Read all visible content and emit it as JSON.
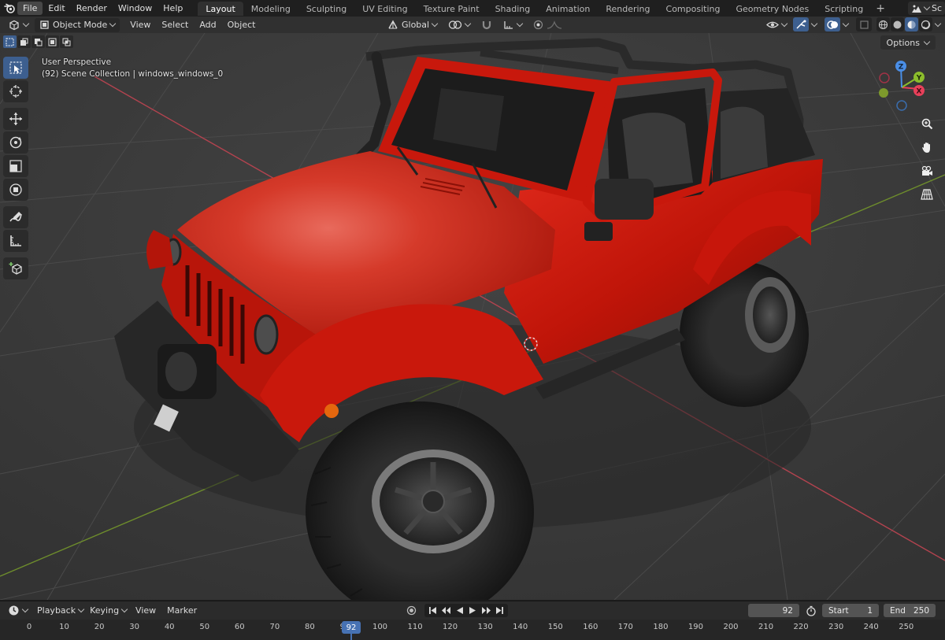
{
  "menubar": {
    "items": [
      "File",
      "Edit",
      "Render",
      "Window",
      "Help"
    ],
    "active_item": "File"
  },
  "workspace_tabs": {
    "tabs": [
      "Layout",
      "Modeling",
      "Sculpting",
      "UV Editing",
      "Texture Paint",
      "Shading",
      "Animation",
      "Rendering",
      "Compositing",
      "Geometry Nodes",
      "Scripting"
    ],
    "active": "Layout",
    "add": "+"
  },
  "scene_selector": {
    "label": "Sc"
  },
  "viewport_header": {
    "mode": "Object Mode",
    "menus": [
      "View",
      "Select",
      "Add",
      "Object"
    ],
    "transform_orientation": "Global"
  },
  "viewport": {
    "view_name": "User Perspective",
    "collection_info": "(92) Scene Collection | windows_windows_0",
    "options_label": "Options",
    "gizmo_axes": {
      "x": "X",
      "y": "Y",
      "z": "Z"
    },
    "colors": {
      "x_axis": "#e8405a",
      "y_axis": "#8cbd2c",
      "z_axis": "#4a8ee6",
      "car_body": "#c2170d",
      "grid": "#444444"
    }
  },
  "toolbar": {
    "tools": [
      "select-box",
      "cursor",
      "move",
      "rotate",
      "scale",
      "transform",
      "annotate",
      "measure",
      "add-cube"
    ],
    "active_tool": "select-box"
  },
  "timeline": {
    "menus": [
      "Playback",
      "Keying",
      "View",
      "Marker"
    ],
    "current_frame": "92",
    "start_label": "Start",
    "start_value": "1",
    "end_label": "End",
    "end_value": "250",
    "ruler_ticks": [
      "0",
      "10",
      "20",
      "30",
      "40",
      "50",
      "60",
      "70",
      "80",
      "90",
      "100",
      "110",
      "120",
      "130",
      "140",
      "150",
      "160",
      "170",
      "180",
      "190",
      "200",
      "210",
      "220",
      "230",
      "240",
      "250"
    ],
    "playhead_label": "92"
  }
}
